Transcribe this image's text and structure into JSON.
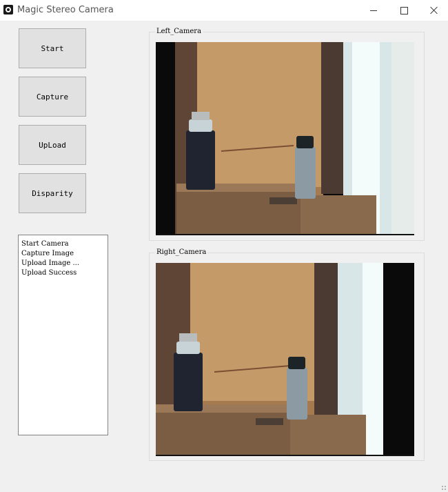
{
  "window": {
    "title": "Magic Stereo Camera",
    "icon": "camera-icon"
  },
  "controls": {
    "start_label": "Start",
    "capture_label": "Capture",
    "upload_label": "UpLoad",
    "disparity_label": "Disparity"
  },
  "log": {
    "lines": [
      "Start Camera",
      "Capture Image",
      "Upload Image ...",
      "Upload Success"
    ]
  },
  "cameras": {
    "left_label": "Left_Camera",
    "right_label": "Right_Camera"
  }
}
